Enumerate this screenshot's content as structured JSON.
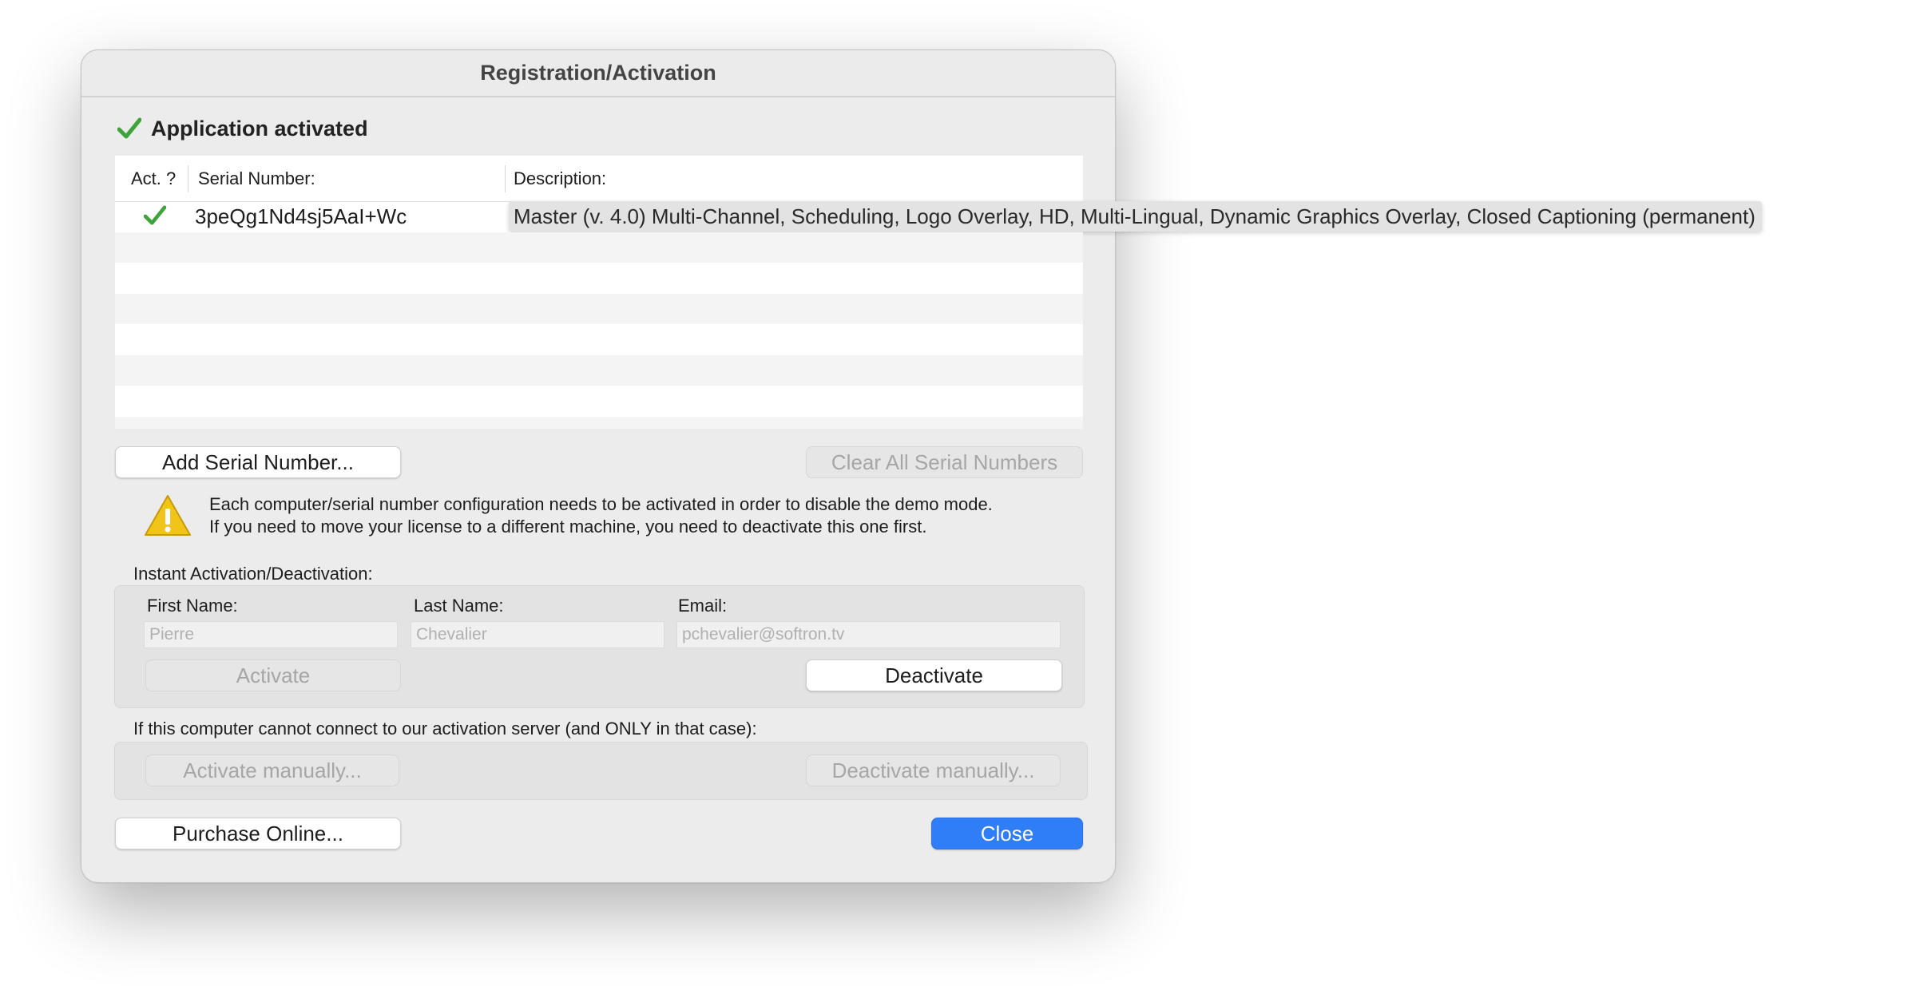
{
  "window": {
    "title": "Registration/Activation"
  },
  "status": {
    "text": "Application activated",
    "icon": "checkmark-icon",
    "color": "#3ea33a"
  },
  "table": {
    "columns": [
      "Act. ?",
      "Serial Number:",
      "Description:"
    ],
    "rows": [
      {
        "activated": true,
        "serial": "3peQg1Nd4sj5AaI+Wc",
        "description": "Master (v. 4.0) Multi-Channel, Scheduling, Logo Overlay, HD, Multi-Lingual, Dynamic Graphics Overlay, Closed Captioning (permanent)"
      }
    ]
  },
  "buttons": {
    "add_serial": "Add Serial Number...",
    "clear_all": "Clear All Serial Numbers",
    "activate": "Activate",
    "deactivate": "Deactivate",
    "activate_manually": "Activate manually...",
    "deactivate_manually": "Deactivate manually...",
    "purchase": "Purchase Online...",
    "close": "Close"
  },
  "warning": {
    "icon": "warning-icon",
    "line1": "Each computer/serial number configuration needs to be activated in order to disable the demo mode.",
    "line2": "If you need to move your license to a different machine, you need to deactivate this one first."
  },
  "instant": {
    "label": "Instant Activation/Deactivation:",
    "first_name_label": "First Name:",
    "last_name_label": "Last Name:",
    "email_label": "Email:",
    "first_name_value": "Pierre",
    "last_name_value": "Chevalier",
    "email_value": "pchevalier@softron.tv"
  },
  "manual": {
    "label": "If this computer cannot connect to our activation server (and ONLY in that case):"
  },
  "colors": {
    "accent": "#2f7df7",
    "check": "#3ea33a",
    "warning": "#f0c419"
  }
}
